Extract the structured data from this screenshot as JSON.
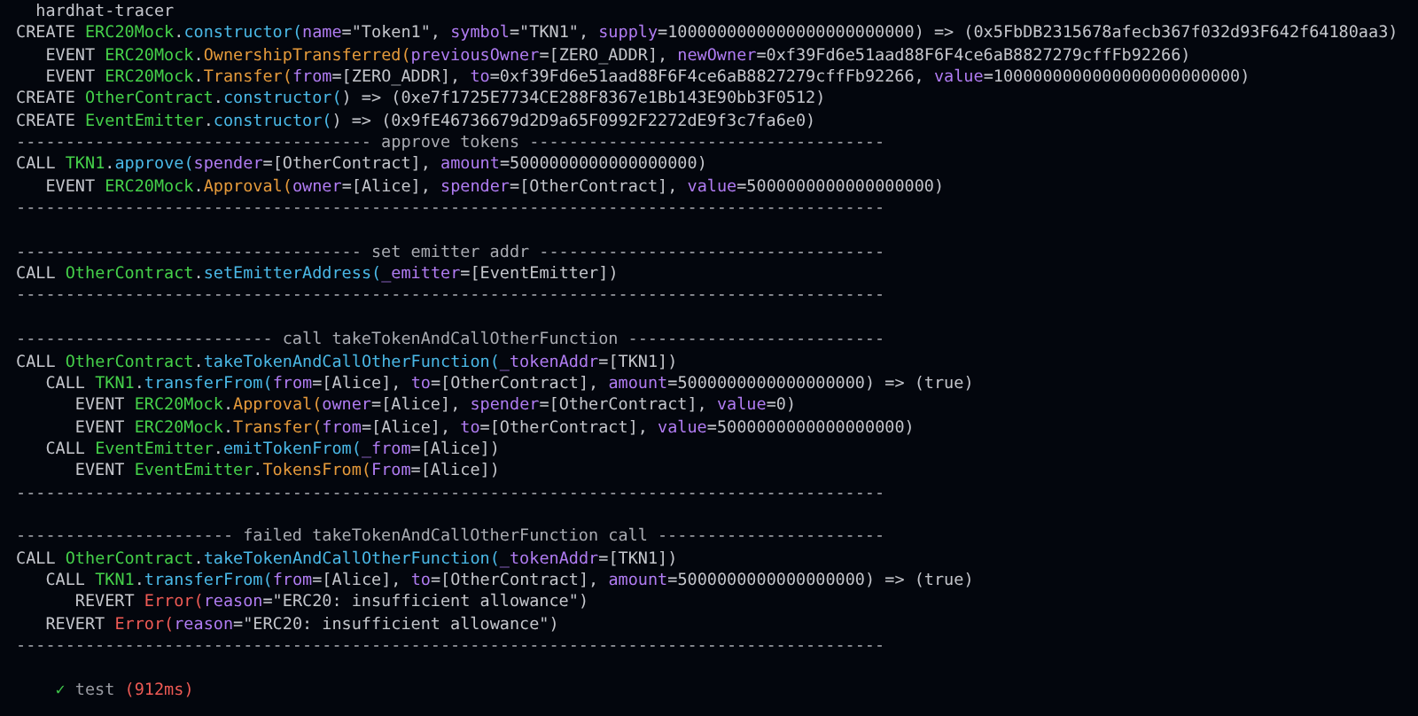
{
  "title": "hardhat-tracer",
  "lines": [
    {
      "kind": "trace",
      "segments": [
        {
          "text": "CREATE ",
          "kind": "keyword"
        },
        {
          "text": "ERC20Mock",
          "kind": "contract"
        },
        {
          "text": ".",
          "kind": "plain"
        },
        {
          "text": "constructor(",
          "kind": "method"
        },
        {
          "text": "name",
          "kind": "param"
        },
        {
          "text": "=\"Token1\", ",
          "kind": "plain"
        },
        {
          "text": "symbol",
          "kind": "param"
        },
        {
          "text": "=\"TKN1\", ",
          "kind": "plain"
        },
        {
          "text": "supply",
          "kind": "param"
        },
        {
          "text": "=1000000000000000000000000) => (0x5FbDB2315678afecb367f032d93F642f64180aa3)",
          "kind": "plain"
        }
      ],
      "children": [
        {
          "kind": "trace",
          "segments": [
            {
              "text": "EVENT ",
              "kind": "keyword"
            },
            {
              "text": "ERC20Mock",
              "kind": "contract"
            },
            {
              "text": ".",
              "kind": "plain"
            },
            {
              "text": "OwnershipTransferred(",
              "kind": "event"
            },
            {
              "text": "previousOwner",
              "kind": "param"
            },
            {
              "text": "=[ZERO_ADDR], ",
              "kind": "plain"
            },
            {
              "text": "newOwner",
              "kind": "param"
            },
            {
              "text": "=0xf39Fd6e51aad88F6F4ce6aB8827279cffFb92266)",
              "kind": "plain"
            }
          ]
        },
        {
          "kind": "trace",
          "segments": [
            {
              "text": "EVENT ",
              "kind": "keyword"
            },
            {
              "text": "ERC20Mock",
              "kind": "contract"
            },
            {
              "text": ".",
              "kind": "plain"
            },
            {
              "text": "Transfer(",
              "kind": "event"
            },
            {
              "text": "from",
              "kind": "param"
            },
            {
              "text": "=[ZERO_ADDR], ",
              "kind": "plain"
            },
            {
              "text": "to",
              "kind": "param"
            },
            {
              "text": "=0xf39Fd6e51aad88F6F4ce6aB8827279cffFb92266, ",
              "kind": "plain"
            },
            {
              "text": "value",
              "kind": "param"
            },
            {
              "text": "=1000000000000000000000000)",
              "kind": "plain"
            }
          ]
        }
      ]
    },
    {
      "kind": "trace",
      "segments": [
        {
          "text": "CREATE ",
          "kind": "keyword"
        },
        {
          "text": "OtherContract",
          "kind": "contract"
        },
        {
          "text": ".",
          "kind": "plain"
        },
        {
          "text": "constructor(",
          "kind": "method"
        },
        {
          "text": ") => (0xe7f1725E7734CE288F8367e1Bb143E90bb3F0512)",
          "kind": "plain"
        }
      ]
    },
    {
      "kind": "trace",
      "segments": [
        {
          "text": "CREATE ",
          "kind": "keyword"
        },
        {
          "text": "EventEmitter",
          "kind": "contract"
        },
        {
          "text": ".",
          "kind": "plain"
        },
        {
          "text": "constructor(",
          "kind": "method"
        },
        {
          "text": ") => (0x9fE46736679d2D9a65F0992F2272dE9f3c7fa6e0)",
          "kind": "plain"
        }
      ]
    },
    {
      "kind": "divider",
      "text": "------------------------------------ approve tokens ------------------------------------"
    },
    {
      "kind": "trace",
      "segments": [
        {
          "text": "CALL ",
          "kind": "keyword"
        },
        {
          "text": "TKN1",
          "kind": "contract"
        },
        {
          "text": ".",
          "kind": "plain"
        },
        {
          "text": "approve(",
          "kind": "method"
        },
        {
          "text": "spender",
          "kind": "param"
        },
        {
          "text": "=[OtherContract], ",
          "kind": "plain"
        },
        {
          "text": "amount",
          "kind": "param"
        },
        {
          "text": "=5000000000000000000)",
          "kind": "plain"
        }
      ],
      "children": [
        {
          "kind": "trace",
          "segments": [
            {
              "text": "EVENT ",
              "kind": "keyword"
            },
            {
              "text": "ERC20Mock",
              "kind": "contract"
            },
            {
              "text": ".",
              "kind": "plain"
            },
            {
              "text": "Approval(",
              "kind": "event"
            },
            {
              "text": "owner",
              "kind": "param"
            },
            {
              "text": "=[Alice], ",
              "kind": "plain"
            },
            {
              "text": "spender",
              "kind": "param"
            },
            {
              "text": "=[OtherContract], ",
              "kind": "plain"
            },
            {
              "text": "value",
              "kind": "param"
            },
            {
              "text": "=5000000000000000000)",
              "kind": "plain"
            }
          ]
        }
      ]
    },
    {
      "kind": "divider",
      "text": "----------------------------------------------------------------------------------------"
    },
    {
      "kind": "blank"
    },
    {
      "kind": "divider",
      "text": "----------------------------------- set emitter addr -----------------------------------"
    },
    {
      "kind": "trace",
      "segments": [
        {
          "text": "CALL ",
          "kind": "keyword"
        },
        {
          "text": "OtherContract",
          "kind": "contract"
        },
        {
          "text": ".",
          "kind": "plain"
        },
        {
          "text": "setEmitterAddress(",
          "kind": "method"
        },
        {
          "text": "_emitter",
          "kind": "param"
        },
        {
          "text": "=[EventEmitter])",
          "kind": "plain"
        }
      ]
    },
    {
      "kind": "divider",
      "text": "----------------------------------------------------------------------------------------"
    },
    {
      "kind": "blank"
    },
    {
      "kind": "divider",
      "text": "-------------------------- call takeTokenAndCallOtherFunction --------------------------"
    },
    {
      "kind": "trace",
      "segments": [
        {
          "text": "CALL ",
          "kind": "keyword"
        },
        {
          "text": "OtherContract",
          "kind": "contract"
        },
        {
          "text": ".",
          "kind": "plain"
        },
        {
          "text": "takeTokenAndCallOtherFunction(",
          "kind": "method"
        },
        {
          "text": "_tokenAddr",
          "kind": "param"
        },
        {
          "text": "=[TKN1])",
          "kind": "plain"
        }
      ],
      "children": [
        {
          "kind": "trace",
          "segments": [
            {
              "text": "CALL ",
              "kind": "keyword"
            },
            {
              "text": "TKN1",
              "kind": "contract"
            },
            {
              "text": ".",
              "kind": "plain"
            },
            {
              "text": "transferFrom(",
              "kind": "method"
            },
            {
              "text": "from",
              "kind": "param"
            },
            {
              "text": "=[Alice], ",
              "kind": "plain"
            },
            {
              "text": "to",
              "kind": "param"
            },
            {
              "text": "=[OtherContract], ",
              "kind": "plain"
            },
            {
              "text": "amount",
              "kind": "param"
            },
            {
              "text": "=5000000000000000000) => (true)",
              "kind": "plain"
            }
          ],
          "children": [
            {
              "kind": "trace",
              "segments": [
                {
                  "text": "EVENT ",
                  "kind": "keyword"
                },
                {
                  "text": "ERC20Mock",
                  "kind": "contract"
                },
                {
                  "text": ".",
                  "kind": "plain"
                },
                {
                  "text": "Approval(",
                  "kind": "event"
                },
                {
                  "text": "owner",
                  "kind": "param"
                },
                {
                  "text": "=[Alice], ",
                  "kind": "plain"
                },
                {
                  "text": "spender",
                  "kind": "param"
                },
                {
                  "text": "=[OtherContract], ",
                  "kind": "plain"
                },
                {
                  "text": "value",
                  "kind": "param"
                },
                {
                  "text": "=0)",
                  "kind": "plain"
                }
              ]
            },
            {
              "kind": "trace",
              "segments": [
                {
                  "text": "EVENT ",
                  "kind": "keyword"
                },
                {
                  "text": "ERC20Mock",
                  "kind": "contract"
                },
                {
                  "text": ".",
                  "kind": "plain"
                },
                {
                  "text": "Transfer(",
                  "kind": "event"
                },
                {
                  "text": "from",
                  "kind": "param"
                },
                {
                  "text": "=[Alice], ",
                  "kind": "plain"
                },
                {
                  "text": "to",
                  "kind": "param"
                },
                {
                  "text": "=[OtherContract], ",
                  "kind": "plain"
                },
                {
                  "text": "value",
                  "kind": "param"
                },
                {
                  "text": "=5000000000000000000)",
                  "kind": "plain"
                }
              ]
            }
          ]
        },
        {
          "kind": "trace",
          "segments": [
            {
              "text": "CALL ",
              "kind": "keyword"
            },
            {
              "text": "EventEmitter",
              "kind": "contract"
            },
            {
              "text": ".",
              "kind": "plain"
            },
            {
              "text": "emitTokenFrom(",
              "kind": "method"
            },
            {
              "text": "_from",
              "kind": "param"
            },
            {
              "text": "=[Alice])",
              "kind": "plain"
            }
          ],
          "children": [
            {
              "kind": "trace",
              "segments": [
                {
                  "text": "EVENT ",
                  "kind": "keyword"
                },
                {
                  "text": "EventEmitter",
                  "kind": "contract"
                },
                {
                  "text": ".",
                  "kind": "plain"
                },
                {
                  "text": "TokensFrom(",
                  "kind": "event"
                },
                {
                  "text": "From",
                  "kind": "param"
                },
                {
                  "text": "=[Alice])",
                  "kind": "plain"
                }
              ]
            }
          ]
        }
      ]
    },
    {
      "kind": "divider",
      "text": "----------------------------------------------------------------------------------------"
    },
    {
      "kind": "blank"
    },
    {
      "kind": "divider",
      "text": "---------------------- failed takeTokenAndCallOtherFunction call -----------------------"
    },
    {
      "kind": "trace",
      "segments": [
        {
          "text": "CALL ",
          "kind": "keyword"
        },
        {
          "text": "OtherContract",
          "kind": "contract"
        },
        {
          "text": ".",
          "kind": "plain"
        },
        {
          "text": "takeTokenAndCallOtherFunction(",
          "kind": "method"
        },
        {
          "text": "_tokenAddr",
          "kind": "param"
        },
        {
          "text": "=[TKN1])",
          "kind": "plain"
        }
      ],
      "children": [
        {
          "kind": "trace",
          "segments": [
            {
              "text": "CALL ",
              "kind": "keyword"
            },
            {
              "text": "TKN1",
              "kind": "contract"
            },
            {
              "text": ".",
              "kind": "plain"
            },
            {
              "text": "transferFrom(",
              "kind": "method"
            },
            {
              "text": "from",
              "kind": "param"
            },
            {
              "text": "=[Alice], ",
              "kind": "plain"
            },
            {
              "text": "to",
              "kind": "param"
            },
            {
              "text": "=[OtherContract], ",
              "kind": "plain"
            },
            {
              "text": "amount",
              "kind": "param"
            },
            {
              "text": "=5000000000000000000) => (true)",
              "kind": "plain"
            }
          ],
          "children": [
            {
              "kind": "trace",
              "segments": [
                {
                  "text": "REVERT ",
                  "kind": "keyword"
                },
                {
                  "text": "Error(",
                  "kind": "error"
                },
                {
                  "text": "reason",
                  "kind": "param"
                },
                {
                  "text": "=\"ERC20: insufficient allowance\")",
                  "kind": "plain"
                }
              ]
            }
          ]
        },
        {
          "kind": "trace",
          "segments": [
            {
              "text": "REVERT ",
              "kind": "keyword"
            },
            {
              "text": "Error(",
              "kind": "error"
            },
            {
              "text": "reason",
              "kind": "param"
            },
            {
              "text": "=\"ERC20: insufficient allowance\")",
              "kind": "plain"
            }
          ]
        }
      ]
    },
    {
      "kind": "divider",
      "text": "----------------------------------------------------------------------------------------"
    },
    {
      "kind": "blank"
    }
  ],
  "result": {
    "mark": "✓",
    "name": "test",
    "duration": "(912ms)"
  }
}
